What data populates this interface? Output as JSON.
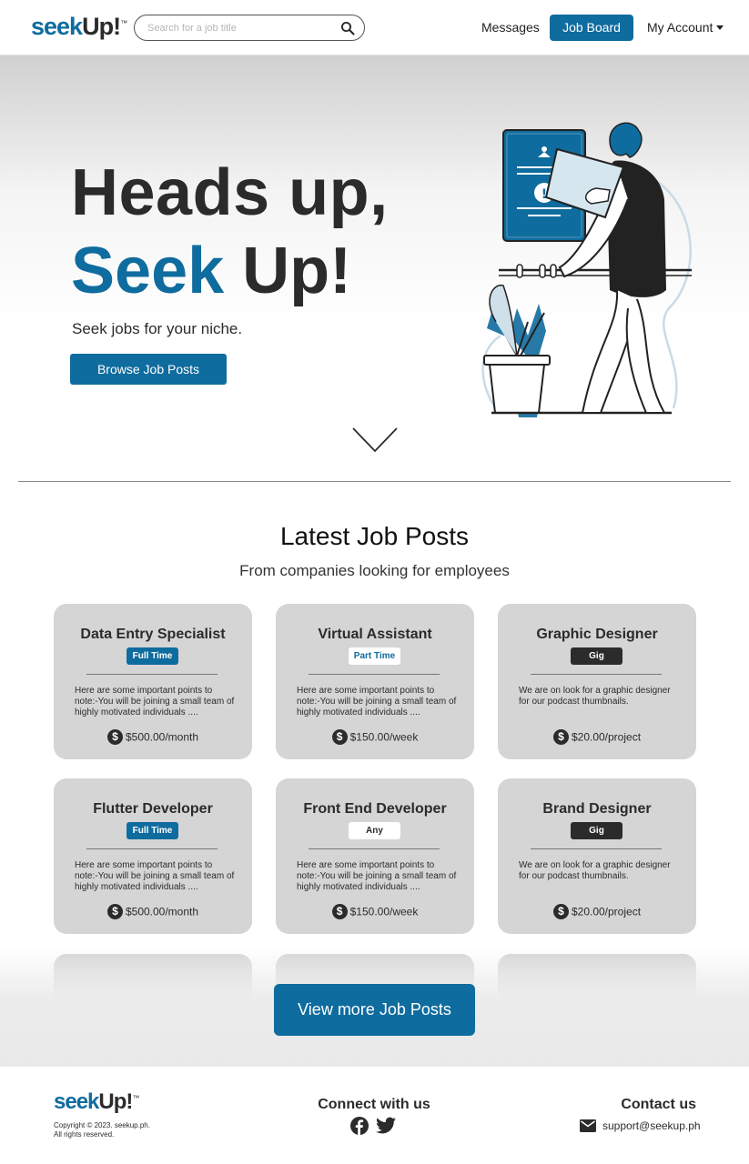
{
  "header": {
    "logo_a": "seek",
    "logo_b": "Up!",
    "logo_tm": "™",
    "search_placeholder": "Search for a job title",
    "nav_messages": "Messages",
    "nav_job_board": "Job Board",
    "nav_account": "My Account"
  },
  "hero": {
    "line1": "Heads up,",
    "line2_blue": "Seek",
    "line2_dark": "Up!",
    "tagline": "Seek jobs for your niche.",
    "cta": "Browse Job Posts"
  },
  "latest": {
    "title": "Latest Job Posts",
    "subtitle": "From companies looking for employees",
    "currency_symbol": "$",
    "jobs": [
      {
        "title": "Data Entry Specialist",
        "type": "Full Time",
        "desc": "Here are some important points to note:-You will be joining a small team of highly motivated individuals ....",
        "pay": "$500.00/month"
      },
      {
        "title": "Virtual Assistant",
        "type": "Part Time",
        "desc": "Here are some important points to note:-You will be joining a small team of highly motivated individuals ....",
        "pay": "$150.00/week"
      },
      {
        "title": "Graphic Designer",
        "type": "Gig",
        "desc": "We are on look for a graphic designer for our podcast thumbnails.",
        "pay": "$20.00/project"
      },
      {
        "title": "Flutter Developer",
        "type": "Full Time",
        "desc": "Here are some important points to note:-You will be joining a small team of highly motivated individuals ....",
        "pay": "$500.00/month"
      },
      {
        "title": "Front End Developer",
        "type": "Any",
        "desc": "Here are some important points to note:-You will be joining a small team of highly motivated individuals ....",
        "pay": "$150.00/week"
      },
      {
        "title": "Brand Designer",
        "type": "Gig",
        "desc": "We are on look for a graphic designer for our podcast thumbnails.",
        "pay": "$20.00/project"
      }
    ],
    "view_more": "View more Job Posts"
  },
  "footer": {
    "copyright_1": "Copyright © 2023. seekup.ph.",
    "copyright_2": "All rights reserved.",
    "connect_title": "Connect with us",
    "contact_title": "Contact us",
    "email": "support@seekup.ph",
    "social_icons": [
      "facebook-icon",
      "twitter-icon"
    ]
  },
  "colors": {
    "brand_blue": "#0f6c9e",
    "dark": "#2b2b2b",
    "card_bg": "#d5d5d5"
  }
}
